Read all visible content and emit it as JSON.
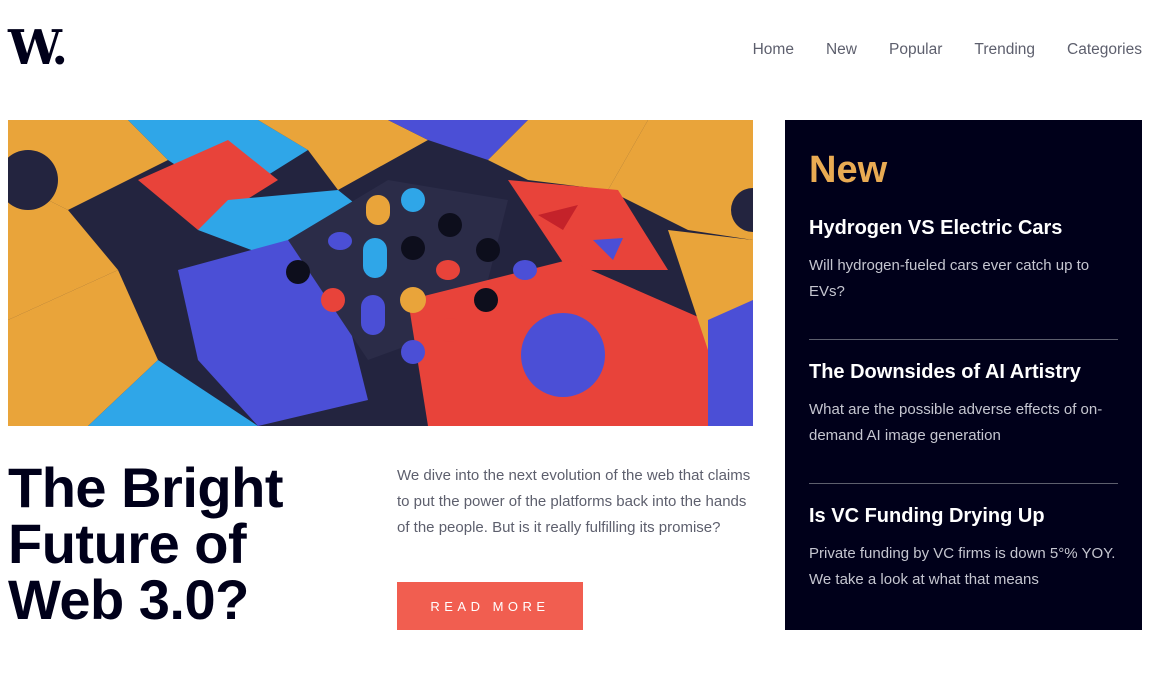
{
  "brand": {
    "logo_text": "W."
  },
  "nav": {
    "items": [
      "Home",
      "New",
      "Popular",
      "Trending",
      "Categories"
    ]
  },
  "hero": {
    "title": "The Bright Future of Web 3.0?",
    "summary": "We dive into the next evolution of the web that claims to put the power of the platforms back into the hands of the people. But is it really fulfilling its promise?",
    "cta_label": "READ MORE"
  },
  "sidebar": {
    "title": "New",
    "items": [
      {
        "title": "Hydrogen VS Electric Cars",
        "text": "Will hydrogen-fueled cars ever catch up to EVs?"
      },
      {
        "title": "The Downsides of AI Artistry",
        "text": "What are the possible adverse effects of on-demand AI image generation"
      },
      {
        "title": "Is VC Funding Drying Up",
        "text": "Private funding by VC firms is down 5°% YOY. We take a look at what that means"
      }
    ]
  },
  "colors": {
    "navy": "#00001a",
    "accent_red": "#f15e50",
    "accent_orange": "#e9ab53",
    "text_grey": "#5d5f6d"
  }
}
